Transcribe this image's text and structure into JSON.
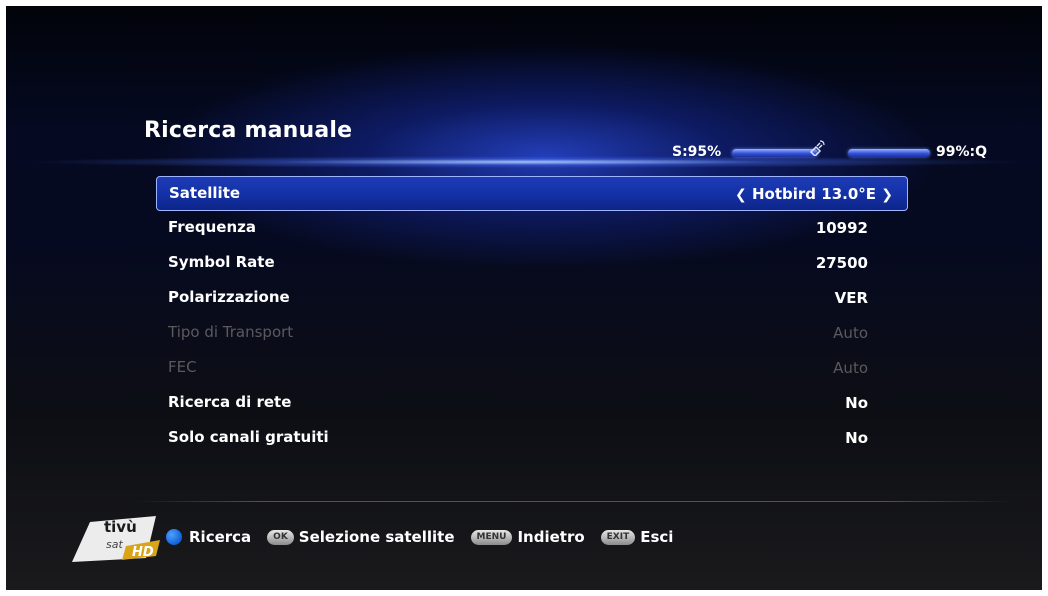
{
  "header": {
    "title": "Ricerca manuale",
    "signal_label": "S:95%",
    "quality_label": "99%:Q",
    "signal_level": 0.95,
    "quality_level": 0.99
  },
  "menu": {
    "items": [
      {
        "label": "Satellite",
        "value": "Hotbird 13.0°E",
        "selected": true,
        "enabled": true
      },
      {
        "label": "Frequenza",
        "value": "10992",
        "selected": false,
        "enabled": true
      },
      {
        "label": "Symbol Rate",
        "value": "27500",
        "selected": false,
        "enabled": true
      },
      {
        "label": "Polarizzazione",
        "value": "VER",
        "selected": false,
        "enabled": true
      },
      {
        "label": "Tipo di Transport",
        "value": "Auto",
        "selected": false,
        "enabled": false
      },
      {
        "label": "FEC",
        "value": "Auto",
        "selected": false,
        "enabled": false
      },
      {
        "label": "Ricerca di rete",
        "value": "No",
        "selected": false,
        "enabled": true
      },
      {
        "label": "Solo canali gratuiti",
        "value": "No",
        "selected": false,
        "enabled": true
      }
    ]
  },
  "footer": {
    "logo_text": "tivù",
    "logo_sub": "sat",
    "logo_hd": "HD",
    "blue_label": "Ricerca",
    "ok_key": "OK",
    "ok_label": "Selezione satellite",
    "menu_key": "MENU",
    "menu_label": "Indietro",
    "exit_key": "EXIT",
    "exit_label": "Esci"
  },
  "colors": {
    "accent": "#1432a8",
    "selection_border": "#9fb4ff",
    "blue_button": "#0f62d6",
    "disabled_text": "#5a5a5e"
  }
}
